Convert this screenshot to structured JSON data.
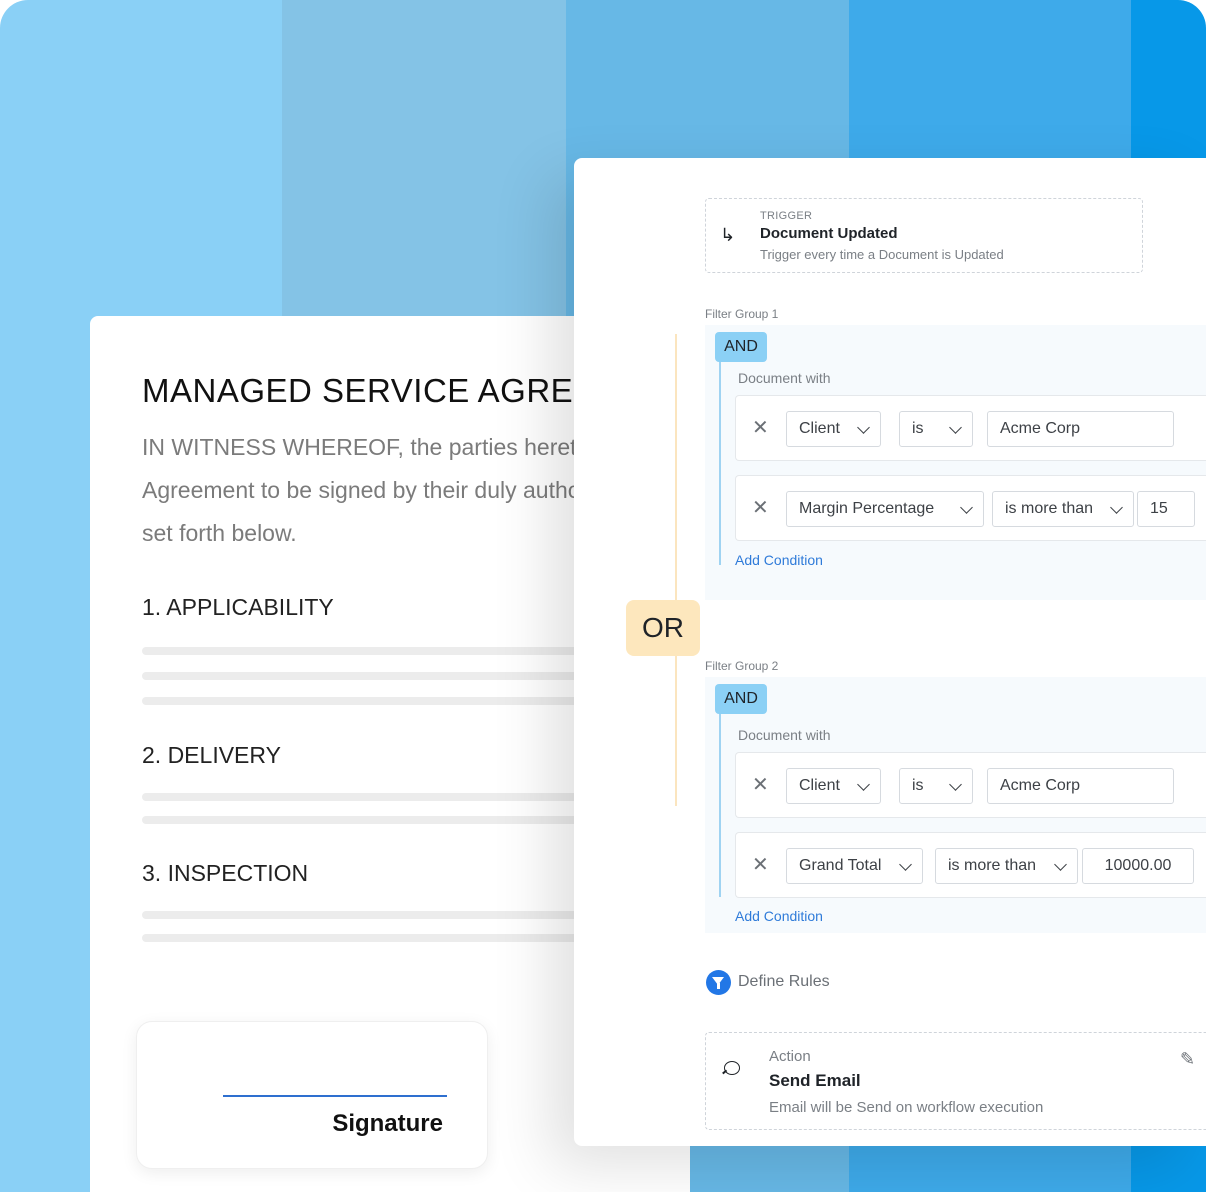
{
  "document": {
    "title": "MANAGED SERVICE AGREEMENT",
    "paragraph_lines": [
      "IN WITNESS WHEREOF, the parties hereto have caused this",
      "Agreement to be signed by their duly authorized representatives as of the date",
      "set forth below."
    ],
    "sections": [
      "1. APPLICABILITY",
      "2. DELIVERY",
      "3. INSPECTION"
    ],
    "signature_label": "Signature"
  },
  "trigger": {
    "label": "TRIGGER",
    "title": "Document Updated",
    "description": "Trigger every time a  Document is Updated",
    "icon": "arrow-return-icon"
  },
  "or_label": "OR",
  "filter_groups": [
    {
      "label": "Filter Group 1",
      "operator": "AND",
      "subject": "Document with",
      "conditions": [
        {
          "field": "Client",
          "comparator": "is",
          "value": "Acme Corp"
        },
        {
          "field": "Margin Percentage",
          "comparator": "is more than",
          "value": "15"
        }
      ],
      "add_label": "Add Condition"
    },
    {
      "label": "Filter Group 2",
      "operator": "AND",
      "subject": "Document with",
      "conditions": [
        {
          "field": "Client",
          "comparator": "is",
          "value": "Acme Corp"
        },
        {
          "field": "Grand Total",
          "comparator": "is more than",
          "value": "10000.00"
        }
      ],
      "add_label": "Add Condition"
    }
  ],
  "define_rules": {
    "label": "Define Rules",
    "icon": "funnel-icon"
  },
  "action": {
    "label": "Action",
    "title": "Send Email",
    "description": "Email will be Send on workflow execution",
    "icon": "chat-icon",
    "edit_icon": "pencil-icon"
  },
  "colors": {
    "accent": "#2277e6",
    "link": "#2f7bd9",
    "and_pill": "#8bd0f5",
    "or_badge": "#fde7bd"
  }
}
